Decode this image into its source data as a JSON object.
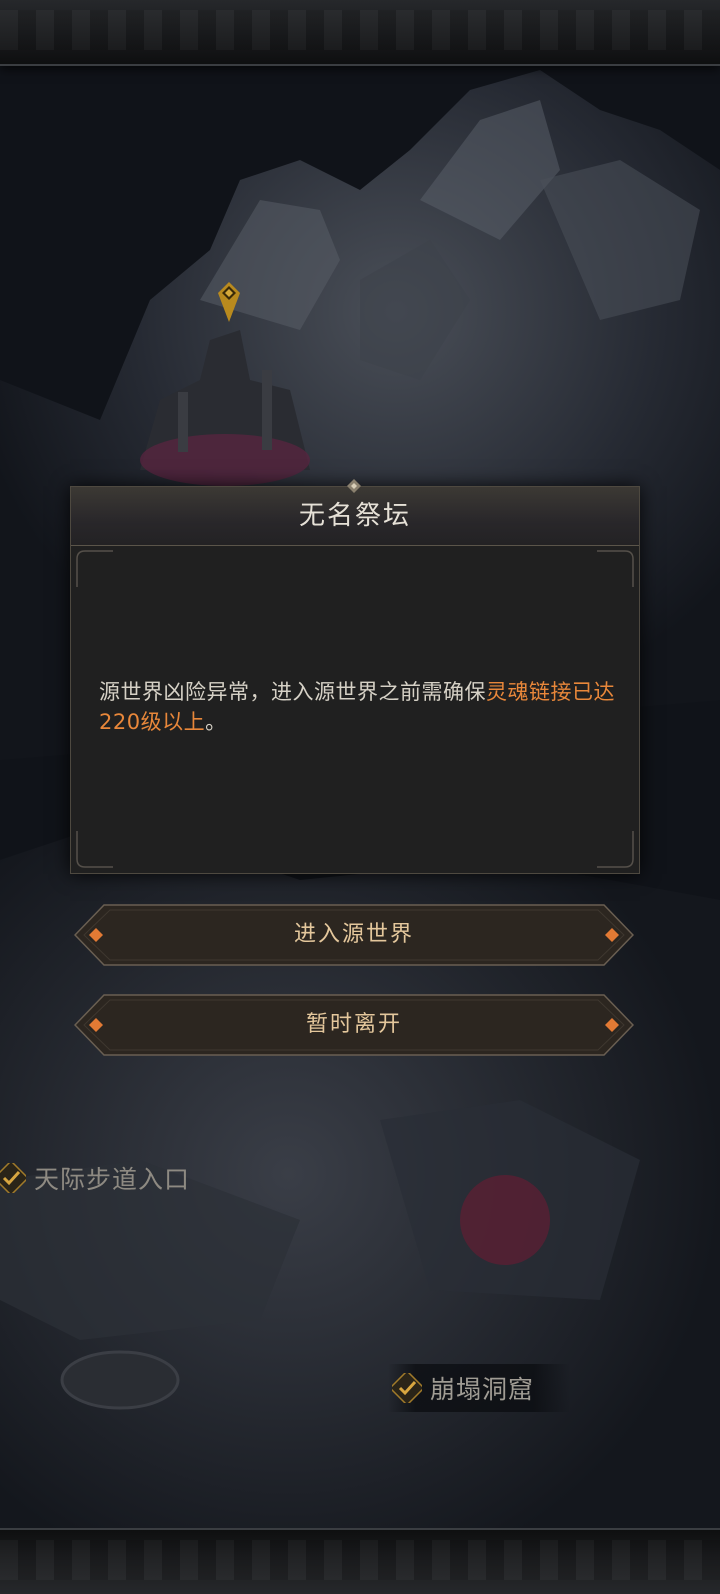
{
  "dialog": {
    "title": "无名祭坛",
    "message_before": "源世界凶险异常，进入源世界之前需确保",
    "message_highlight": "灵魂链接已达220级以上",
    "message_after": "。",
    "highlight_color": "#e8873a"
  },
  "buttons": {
    "enter_label": "进入源世界",
    "leave_label": "暂时离开"
  },
  "map_locations": [
    {
      "label": "天际步道入口",
      "icon": "checkmark-icon"
    },
    {
      "label": "崩塌洞窟",
      "icon": "checkmark-icon"
    }
  ],
  "map_marker_icon": "location-pin-icon"
}
